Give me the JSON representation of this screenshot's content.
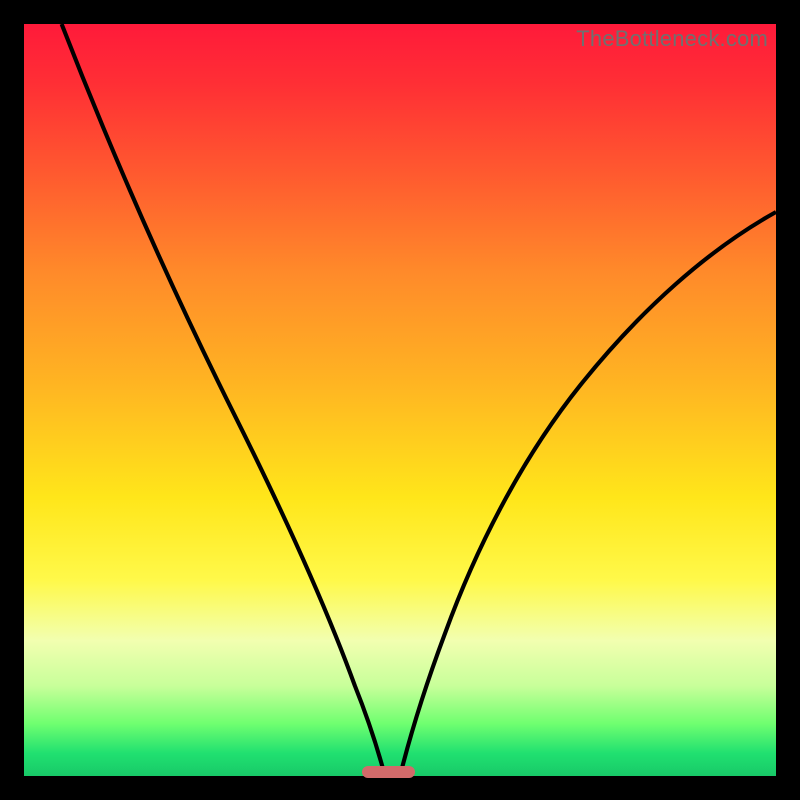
{
  "watermark": "TheBottleneck.com",
  "colors": {
    "frame_bg": "#000000",
    "curve_stroke": "#000000",
    "marker_fill": "#d26a6a",
    "gradient_top": "#ff1a3a",
    "gradient_bottom": "#18c968"
  },
  "chart_data": {
    "type": "line",
    "title": "",
    "xlabel": "",
    "ylabel": "",
    "xlim": [
      0,
      100
    ],
    "ylim": [
      0,
      100
    ],
    "grid": false,
    "legend": false,
    "marker": {
      "x_start": 45,
      "x_end": 52,
      "y": 0
    },
    "series": [
      {
        "name": "left-curve",
        "x": [
          5,
          8,
          12,
          16,
          20,
          24,
          28,
          32,
          36,
          40,
          44,
          46,
          48
        ],
        "y": [
          100,
          93,
          84,
          75,
          66,
          57,
          48,
          39,
          30,
          21,
          11,
          5,
          0
        ]
      },
      {
        "name": "right-curve",
        "x": [
          50,
          52,
          55,
          58,
          62,
          66,
          70,
          75,
          80,
          85,
          90,
          95,
          100
        ],
        "y": [
          0,
          6,
          14,
          22,
          31,
          39,
          46,
          53,
          59,
          64,
          68,
          72,
          75
        ]
      }
    ],
    "note": "Axes unlabeled in source image; x and y values estimated from pixel positions on a 0–100 normalized scale. y=0 is the bottom (green) edge, y=100 the top (red) edge."
  }
}
